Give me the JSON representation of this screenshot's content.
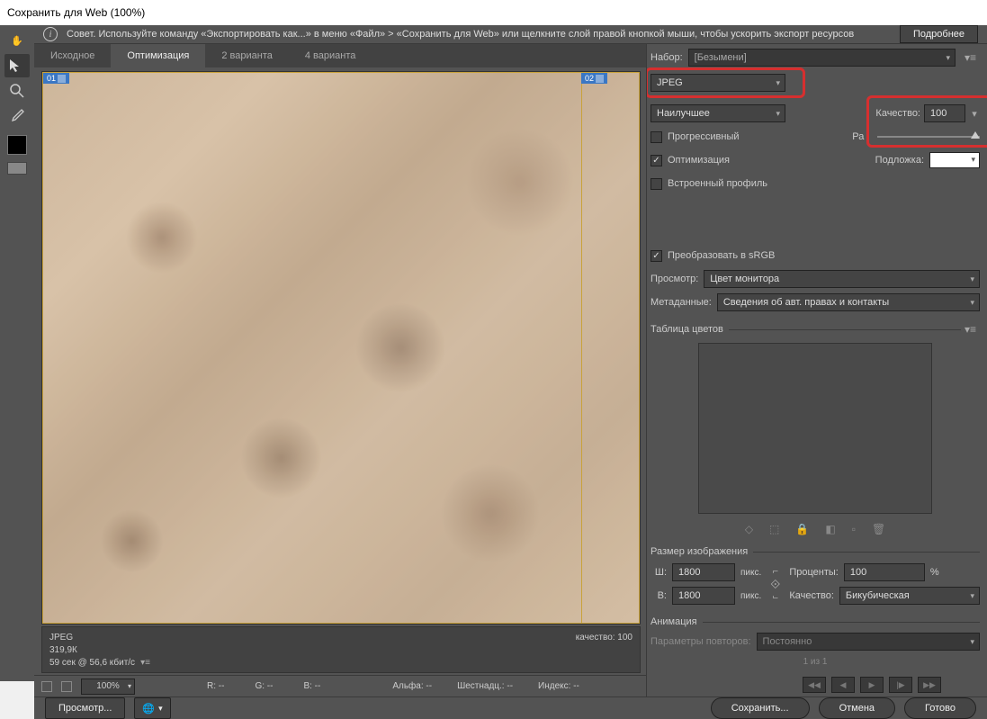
{
  "title": "Сохранить для Web (100%)",
  "infobar": {
    "text": "Совет. Используйте команду «Экспортировать как...» в меню «Файл» > «Сохранить для Web» или щелкните слой правой кнопкой мыши, чтобы ускорить экспорт ресурсов",
    "more": "Подробнее"
  },
  "tabs": {
    "original": "Исходное",
    "optimized": "Оптимизация",
    "two_up": "2 варианта",
    "four_up": "4 варианта"
  },
  "slices": {
    "s1": "01",
    "s2": "02"
  },
  "preview_info": {
    "format": "JPEG",
    "size": "319,9К",
    "time": "59 сек @ 56,6 кбит/с",
    "quality": "качество: 100"
  },
  "status": {
    "zoom": "100%",
    "R": "R: --",
    "G": "G: --",
    "B": "B: --",
    "alpha": "Альфа: --",
    "hex": "Шестнадц.: --",
    "index": "Индекс: --"
  },
  "preset": {
    "label": "Набор:",
    "value": "[Безымени]"
  },
  "format": {
    "value": "JPEG"
  },
  "quality_preset": {
    "value": "Наилучшее"
  },
  "quality": {
    "label": "Качество:",
    "value": "100"
  },
  "blur_prefix": "Ра",
  "progressive": "Прогрессивный",
  "optimized": "Оптимизация",
  "embed": "Встроенный профиль",
  "matte": {
    "label": "Подложка:"
  },
  "convert_srgb": "Преобразовать в sRGB",
  "preview": {
    "label": "Просмотр:",
    "value": "Цвет монитора"
  },
  "metadata": {
    "label": "Метаданные:",
    "value": "Сведения об авт. правах и контакты"
  },
  "color_table": "Таблица цветов",
  "image_size": {
    "header": "Размер изображения",
    "w": "Ш:",
    "w_val": "1800",
    "h": "В:",
    "h_val": "1800",
    "unit": "пикс.",
    "percent": "Проценты:",
    "percent_val": "100",
    "percent_unit": "%",
    "resample": "Качество:",
    "resample_val": "Бикубическая"
  },
  "animation": {
    "header": "Анимация",
    "loop_label": "Параметры повторов:",
    "loop_val": "Постоянно",
    "pager": "1 из 1"
  },
  "buttons": {
    "browser_preview": "Просмотр...",
    "save": "Сохранить...",
    "cancel": "Отмена",
    "done": "Готово"
  }
}
